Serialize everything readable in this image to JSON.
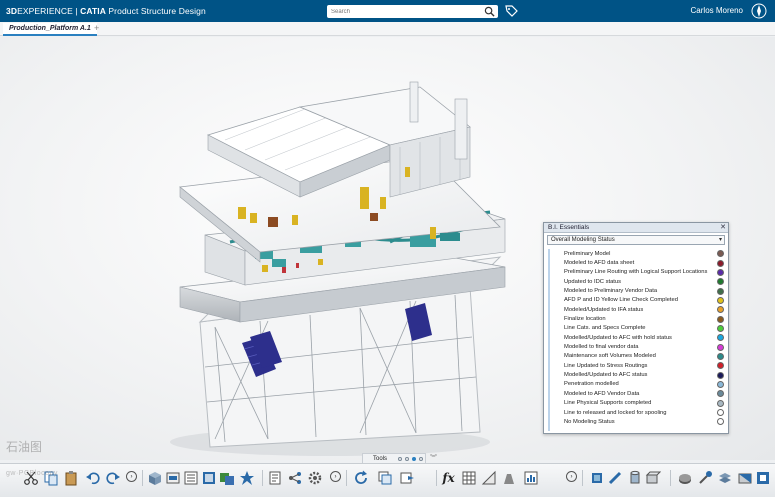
{
  "header": {
    "brand_3d": "3D",
    "brand_rest": "EXPERIENCE | ",
    "brand_app": "CATIA",
    "brand_role": " Product Structure Design",
    "search_placeholder": "Search",
    "user_name": "Carlos Moreno",
    "accent": "#005386"
  },
  "tabs": {
    "active_label": "Production_Platform A.1",
    "add_label": "+"
  },
  "bi_panel": {
    "title": "B.I. Essentials",
    "close_label": "✕",
    "selected_option": "Overall Modeling Status",
    "legend": [
      {
        "label": "Preliminary Model",
        "color": "#7a5a52"
      },
      {
        "label": "Modeled to AFD data sheet",
        "color": "#8b1a2a"
      },
      {
        "label": "Preliminary Line Routing with Logical Support Locations",
        "color": "#5a2aa8"
      },
      {
        "label": "Updated to IDC status",
        "color": "#1f7a2e"
      },
      {
        "label": "Modeled to Preliminary Vendor Data",
        "color": "#3f6e4a"
      },
      {
        "label": "AFD P and ID Yellow Line Check Completed",
        "color": "#e0c21c"
      },
      {
        "label": "Modeled/Updated to IFA status",
        "color": "#e8a12a"
      },
      {
        "label": "Finalize location",
        "color": "#8b5a1e"
      },
      {
        "label": "Line Cats. and Specs Complete",
        "color": "#4ccf3a"
      },
      {
        "label": "Modelled/Updated to AFC with hold status",
        "color": "#1aa8e0"
      },
      {
        "label": "Modelled to final vendor data",
        "color": "#d63ad6"
      },
      {
        "label": "Maintenance soft Volumes Modeled",
        "color": "#2a8a8a"
      },
      {
        "label": "Line Updated to Stress Routings",
        "color": "#d01f2a"
      },
      {
        "label": "Modelled/Updated to AFC status",
        "color": "#1a1a5a"
      },
      {
        "label": "Penetration modelled",
        "color": "#8ab8d8"
      },
      {
        "label": "Modeled to AFD Vendor Data",
        "color": "#6a8a9a"
      },
      {
        "label": "Line Physical Supports completed",
        "color": "#a8b8c2"
      },
      {
        "label": "Line to released and locked for spooling",
        "color": "#ffffff"
      },
      {
        "label": "No Modeling Status",
        "color": "#ffffff"
      }
    ]
  },
  "tools": {
    "label": "Tools",
    "pages": 4,
    "active_page": 3
  },
  "toolbar": {
    "icons": [
      "scissors-icon",
      "copy-icon",
      "paste-icon",
      "undo-icon",
      "redo-icon",
      "more-icon",
      "cube-icon",
      "insert-icon",
      "tree-icon",
      "render-icon",
      "favorite-icon",
      "properties-icon",
      "structure-icon",
      "settings-icon",
      "more-icon",
      "refresh-icon",
      "view-icon",
      "export-icon",
      "formula-icon",
      "table-icon",
      "measure-icon",
      "mass-icon",
      "more-icon",
      "pipe-icon",
      "pen-icon",
      "cylinder-icon",
      "solid-icon",
      "material-icon",
      "paint-icon",
      "stack-icon",
      "cross-section-icon"
    ],
    "formula_label": "fx",
    "more_label": "›"
  },
  "watermark": {
    "line1": "石油图",
    "line2": "gw·PCBlocopy"
  }
}
